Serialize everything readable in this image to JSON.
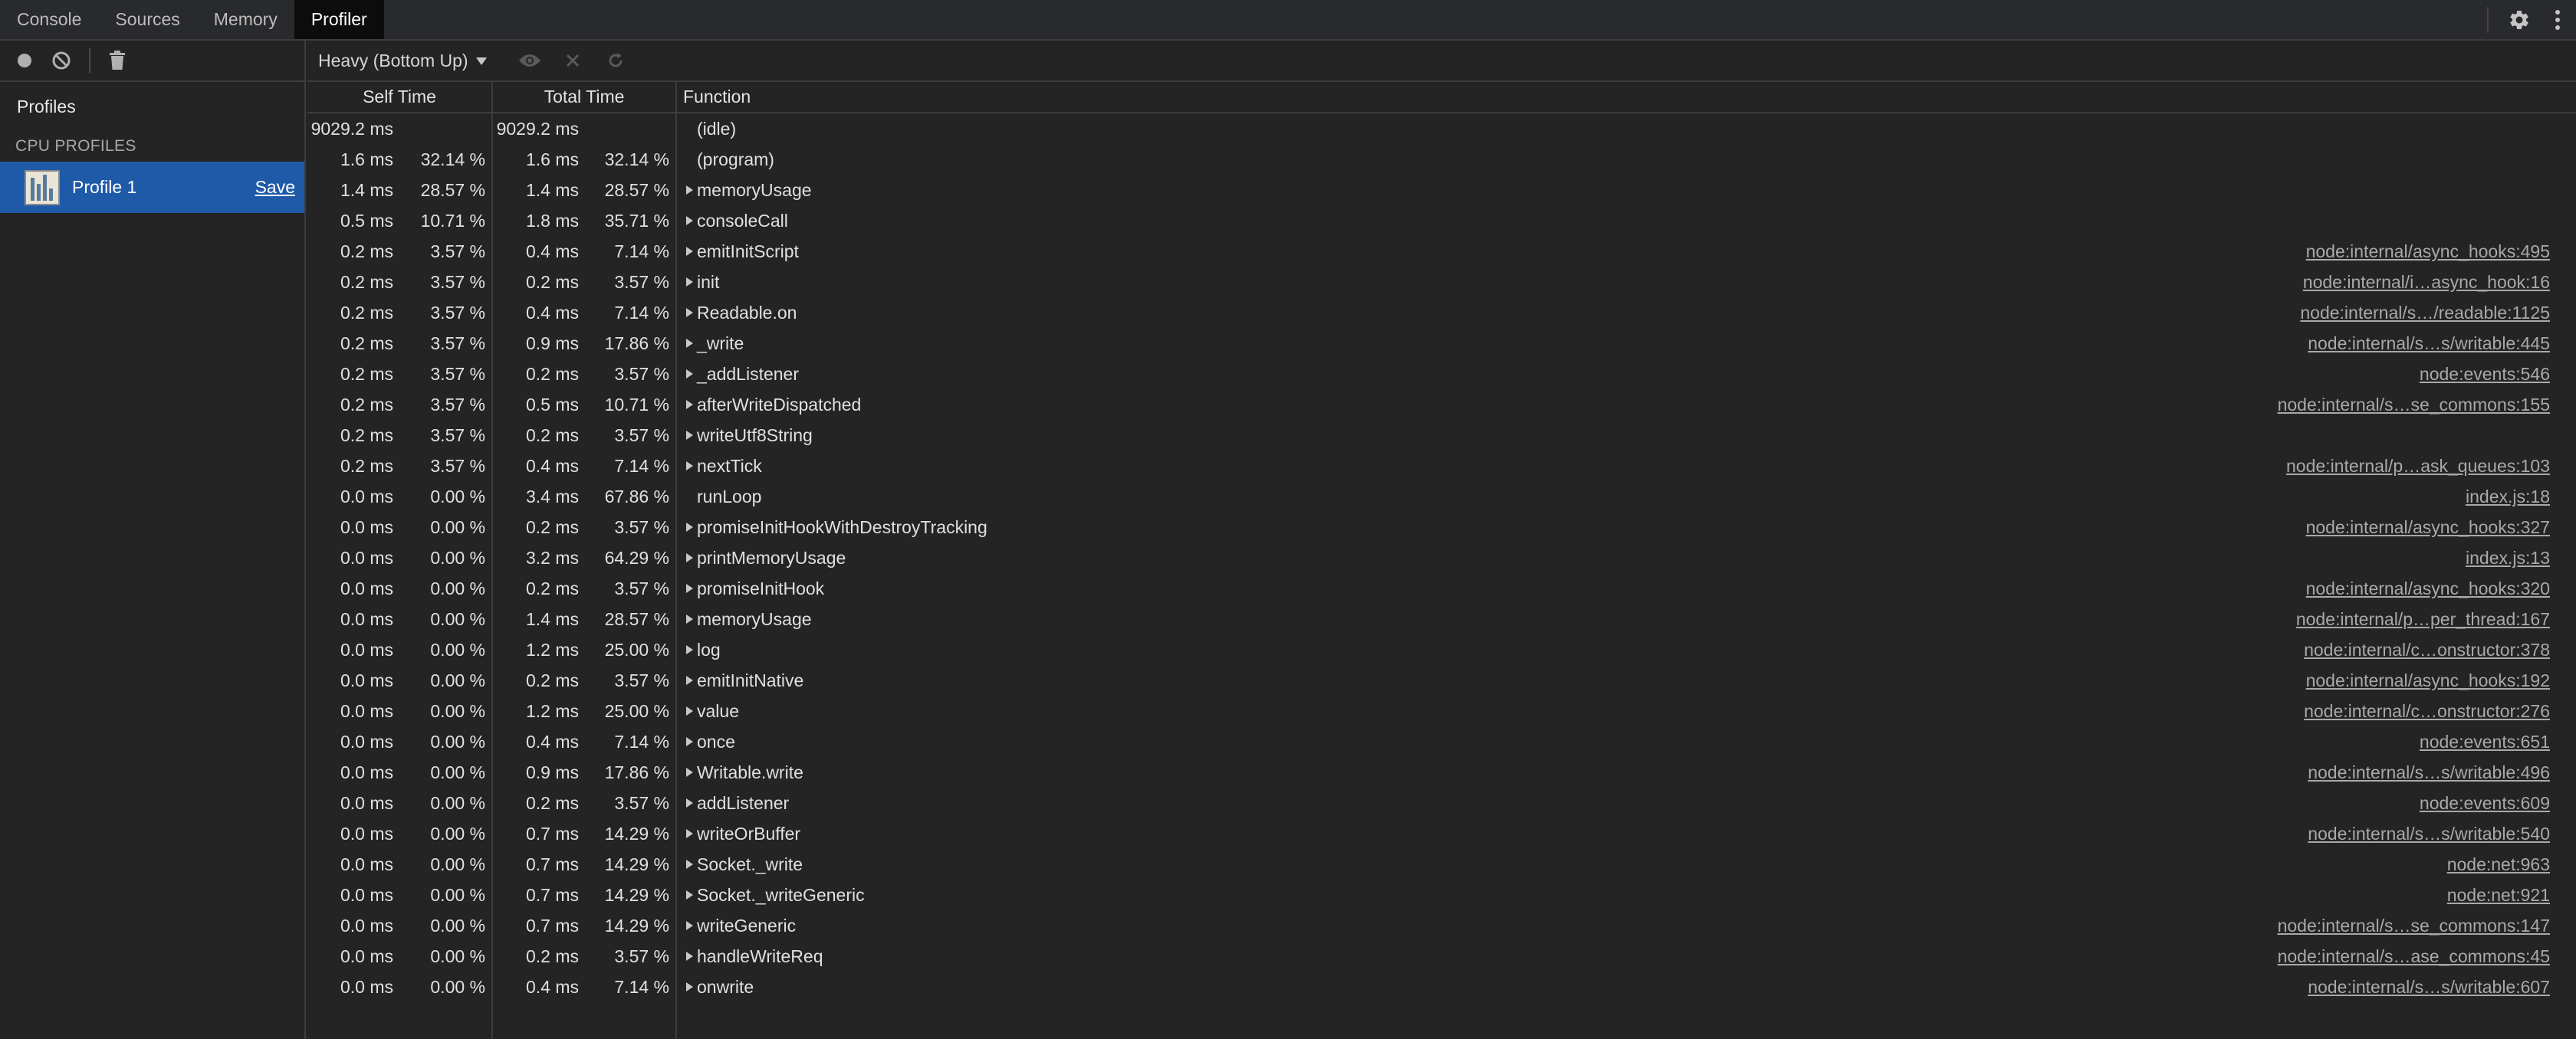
{
  "tabs": [
    {
      "label": "Console",
      "active": false
    },
    {
      "label": "Sources",
      "active": false
    },
    {
      "label": "Memory",
      "active": false
    },
    {
      "label": "Profiler",
      "active": true
    }
  ],
  "sidebar": {
    "title": "Profiles",
    "section": "CPU PROFILES",
    "profile": {
      "name": "Profile 1",
      "save_label": "Save"
    }
  },
  "toolbar": {
    "view_mode": "Heavy (Bottom Up)"
  },
  "table": {
    "headers": {
      "self": "Self Time",
      "total": "Total Time",
      "function": "Function"
    },
    "rows": [
      {
        "self": "9029.2 ms",
        "self_pct": "",
        "total": "9029.2 ms",
        "total_pct": "",
        "fn": "(idle)",
        "expand": false,
        "url": ""
      },
      {
        "self": "1.6 ms",
        "self_pct": "32.14 %",
        "total": "1.6 ms",
        "total_pct": "32.14 %",
        "fn": "(program)",
        "expand": false,
        "url": ""
      },
      {
        "self": "1.4 ms",
        "self_pct": "28.57 %",
        "total": "1.4 ms",
        "total_pct": "28.57 %",
        "fn": "memoryUsage",
        "expand": true,
        "url": ""
      },
      {
        "self": "0.5 ms",
        "self_pct": "10.71 %",
        "total": "1.8 ms",
        "total_pct": "35.71 %",
        "fn": "consoleCall",
        "expand": true,
        "url": ""
      },
      {
        "self": "0.2 ms",
        "self_pct": "3.57 %",
        "total": "0.4 ms",
        "total_pct": "7.14 %",
        "fn": "emitInitScript",
        "expand": true,
        "url": "node:internal/async_hooks:495"
      },
      {
        "self": "0.2 ms",
        "self_pct": "3.57 %",
        "total": "0.2 ms",
        "total_pct": "3.57 %",
        "fn": "init",
        "expand": true,
        "url": "node:internal/i…async_hook:16"
      },
      {
        "self": "0.2 ms",
        "self_pct": "3.57 %",
        "total": "0.4 ms",
        "total_pct": "7.14 %",
        "fn": "Readable.on",
        "expand": true,
        "url": "node:internal/s…/readable:1125"
      },
      {
        "self": "0.2 ms",
        "self_pct": "3.57 %",
        "total": "0.9 ms",
        "total_pct": "17.86 %",
        "fn": "_write",
        "expand": true,
        "url": "node:internal/s…s/writable:445"
      },
      {
        "self": "0.2 ms",
        "self_pct": "3.57 %",
        "total": "0.2 ms",
        "total_pct": "3.57 %",
        "fn": "_addListener",
        "expand": true,
        "url": "node:events:546"
      },
      {
        "self": "0.2 ms",
        "self_pct": "3.57 %",
        "total": "0.5 ms",
        "total_pct": "10.71 %",
        "fn": "afterWriteDispatched",
        "expand": true,
        "url": "node:internal/s…se_commons:155"
      },
      {
        "self": "0.2 ms",
        "self_pct": "3.57 %",
        "total": "0.2 ms",
        "total_pct": "3.57 %",
        "fn": "writeUtf8String",
        "expand": true,
        "url": ""
      },
      {
        "self": "0.2 ms",
        "self_pct": "3.57 %",
        "total": "0.4 ms",
        "total_pct": "7.14 %",
        "fn": "nextTick",
        "expand": true,
        "url": "node:internal/p…ask_queues:103"
      },
      {
        "self": "0.0 ms",
        "self_pct": "0.00 %",
        "total": "3.4 ms",
        "total_pct": "67.86 %",
        "fn": "runLoop",
        "expand": false,
        "url": "index.js:18"
      },
      {
        "self": "0.0 ms",
        "self_pct": "0.00 %",
        "total": "0.2 ms",
        "total_pct": "3.57 %",
        "fn": "promiseInitHookWithDestroyTracking",
        "expand": true,
        "url": "node:internal/async_hooks:327"
      },
      {
        "self": "0.0 ms",
        "self_pct": "0.00 %",
        "total": "3.2 ms",
        "total_pct": "64.29 %",
        "fn": "printMemoryUsage",
        "expand": true,
        "url": "index.js:13"
      },
      {
        "self": "0.0 ms",
        "self_pct": "0.00 %",
        "total": "0.2 ms",
        "total_pct": "3.57 %",
        "fn": "promiseInitHook",
        "expand": true,
        "url": "node:internal/async_hooks:320"
      },
      {
        "self": "0.0 ms",
        "self_pct": "0.00 %",
        "total": "1.4 ms",
        "total_pct": "28.57 %",
        "fn": "memoryUsage",
        "expand": true,
        "url": "node:internal/p…per_thread:167"
      },
      {
        "self": "0.0 ms",
        "self_pct": "0.00 %",
        "total": "1.2 ms",
        "total_pct": "25.00 %",
        "fn": "log",
        "expand": true,
        "url": "node:internal/c…onstructor:378"
      },
      {
        "self": "0.0 ms",
        "self_pct": "0.00 %",
        "total": "0.2 ms",
        "total_pct": "3.57 %",
        "fn": "emitInitNative",
        "expand": true,
        "url": "node:internal/async_hooks:192"
      },
      {
        "self": "0.0 ms",
        "self_pct": "0.00 %",
        "total": "1.2 ms",
        "total_pct": "25.00 %",
        "fn": "value",
        "expand": true,
        "url": "node:internal/c…onstructor:276"
      },
      {
        "self": "0.0 ms",
        "self_pct": "0.00 %",
        "total": "0.4 ms",
        "total_pct": "7.14 %",
        "fn": "once",
        "expand": true,
        "url": "node:events:651"
      },
      {
        "self": "0.0 ms",
        "self_pct": "0.00 %",
        "total": "0.9 ms",
        "total_pct": "17.86 %",
        "fn": "Writable.write",
        "expand": true,
        "url": "node:internal/s…s/writable:496"
      },
      {
        "self": "0.0 ms",
        "self_pct": "0.00 %",
        "total": "0.2 ms",
        "total_pct": "3.57 %",
        "fn": "addListener",
        "expand": true,
        "url": "node:events:609"
      },
      {
        "self": "0.0 ms",
        "self_pct": "0.00 %",
        "total": "0.7 ms",
        "total_pct": "14.29 %",
        "fn": "writeOrBuffer",
        "expand": true,
        "url": "node:internal/s…s/writable:540"
      },
      {
        "self": "0.0 ms",
        "self_pct": "0.00 %",
        "total": "0.7 ms",
        "total_pct": "14.29 %",
        "fn": "Socket._write",
        "expand": true,
        "url": "node:net:963"
      },
      {
        "self": "0.0 ms",
        "self_pct": "0.00 %",
        "total": "0.7 ms",
        "total_pct": "14.29 %",
        "fn": "Socket._writeGeneric",
        "expand": true,
        "url": "node:net:921"
      },
      {
        "self": "0.0 ms",
        "self_pct": "0.00 %",
        "total": "0.7 ms",
        "total_pct": "14.29 %",
        "fn": "writeGeneric",
        "expand": true,
        "url": "node:internal/s…se_commons:147"
      },
      {
        "self": "0.0 ms",
        "self_pct": "0.00 %",
        "total": "0.2 ms",
        "total_pct": "3.57 %",
        "fn": "handleWriteReq",
        "expand": true,
        "url": "node:internal/s…ase_commons:45"
      },
      {
        "self": "0.0 ms",
        "self_pct": "0.00 %",
        "total": "0.4 ms",
        "total_pct": "7.14 %",
        "fn": "onwrite",
        "expand": true,
        "url": "node:internal/s…s/writable:607"
      }
    ]
  }
}
